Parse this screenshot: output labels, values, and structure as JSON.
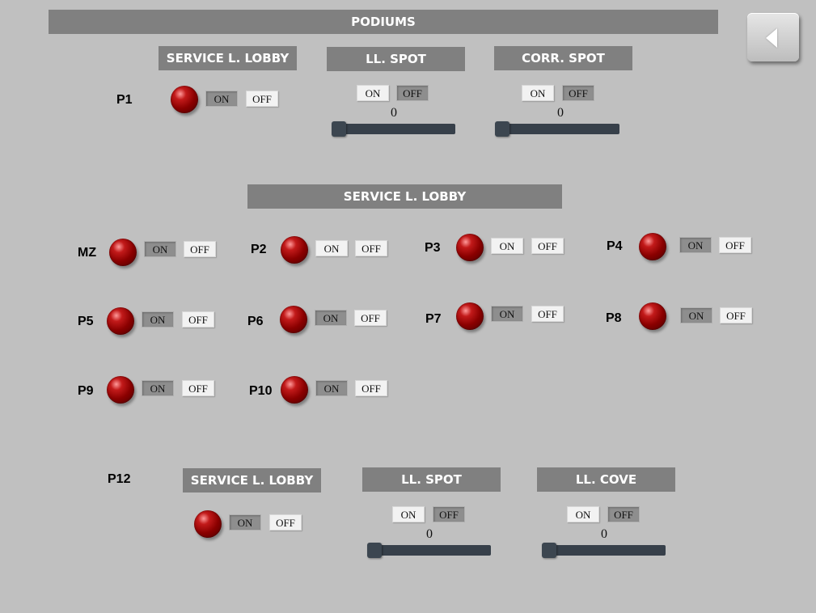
{
  "header": {
    "title": "PODIUMS",
    "back_icon": "back-arrow-icon"
  },
  "p1": {
    "label": "P1",
    "sections": [
      {
        "title": "SERVICE L. LOBBY",
        "on": "ON",
        "off": "OFF"
      },
      {
        "title": "LL. SPOT",
        "on": "ON",
        "off": "OFF",
        "value": "0",
        "level": 0
      },
      {
        "title": "CORR. SPOT",
        "on": "ON",
        "off": "OFF",
        "value": "0",
        "level": 0
      }
    ]
  },
  "lobby": {
    "title": "SERVICE L. LOBBY",
    "items": [
      {
        "label": "MZ",
        "on": "ON",
        "off": "OFF"
      },
      {
        "label": "P2",
        "on": "ON",
        "off": "OFF"
      },
      {
        "label": "P3",
        "on": "ON",
        "off": "OFF"
      },
      {
        "label": "P4",
        "on": "ON",
        "off": "OFF"
      },
      {
        "label": "P5",
        "on": "ON",
        "off": "OFF"
      },
      {
        "label": "P6",
        "on": "ON",
        "off": "OFF"
      },
      {
        "label": "P7",
        "on": "ON",
        "off": "OFF"
      },
      {
        "label": "P8",
        "on": "ON",
        "off": "OFF"
      },
      {
        "label": "P9",
        "on": "ON",
        "off": "OFF"
      },
      {
        "label": "P10",
        "on": "ON",
        "off": "OFF"
      }
    ]
  },
  "p12": {
    "label": "P12",
    "sections": [
      {
        "title": "SERVICE L. LOBBY",
        "on": "ON",
        "off": "OFF"
      },
      {
        "title": "LL. SPOT",
        "on": "ON",
        "off": "OFF",
        "value": "0",
        "level": 0
      },
      {
        "title": "LL. COVE",
        "on": "ON",
        "off": "OFF",
        "value": "0",
        "level": 0
      }
    ]
  },
  "colors": {
    "background": "#c0c0c0",
    "header": "#808080",
    "lamp": "#8a0000"
  }
}
